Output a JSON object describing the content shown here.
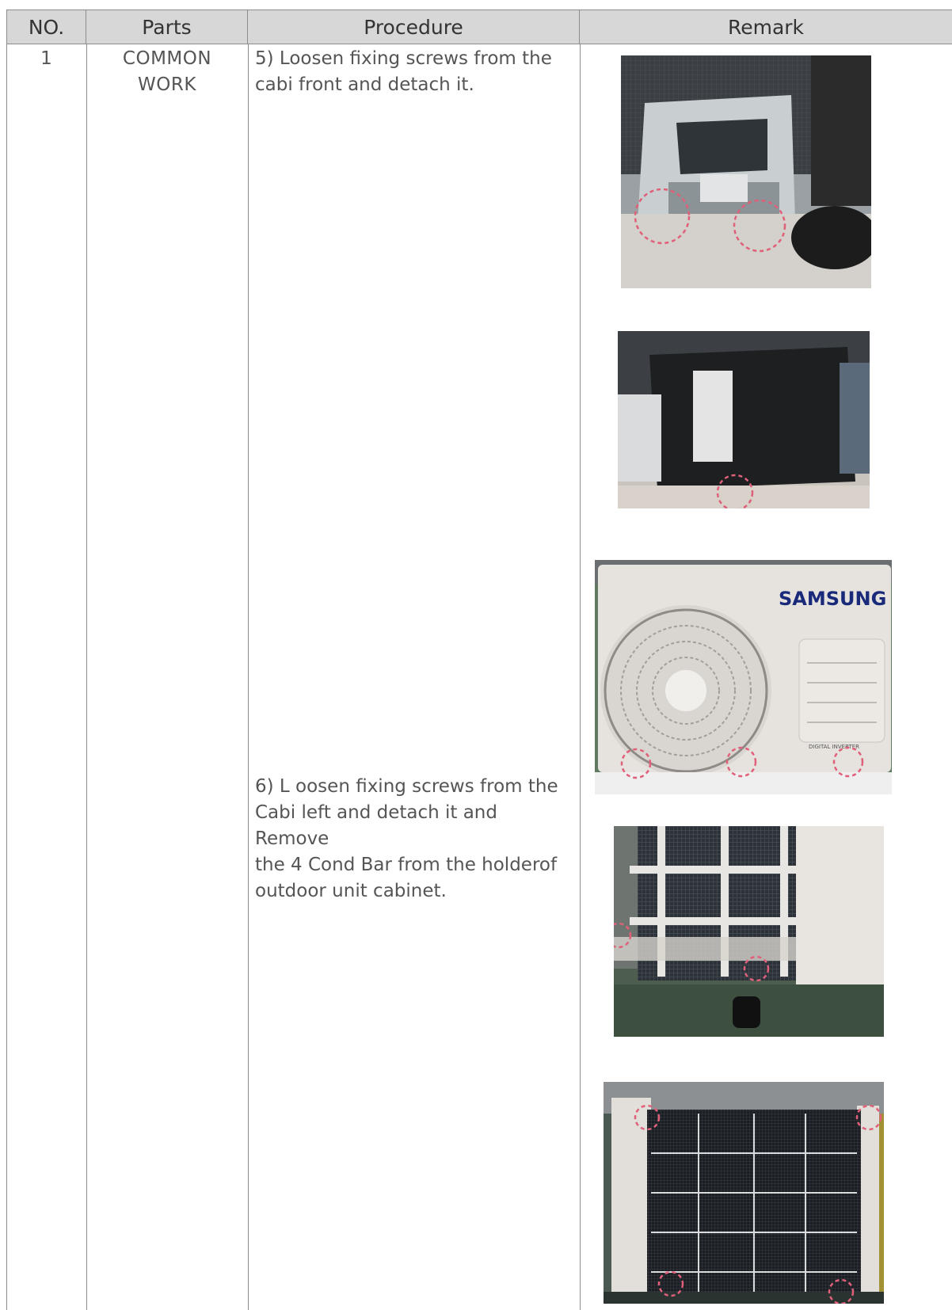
{
  "table": {
    "headers": {
      "no": "NO.",
      "parts": "Parts",
      "procedure": "Procedure",
      "remark": "Remark"
    },
    "row": {
      "no": "1",
      "parts_line1": "COMMON",
      "parts_line2": "WORK",
      "step5_line1": "5) Loosen fixing screws from the",
      "step5_line2": "cabi front and detach it.",
      "step6_line1": "6) L oosen fixing screws from the",
      "step6_line2": "Cabi left and detach it and Remove",
      "step6_line3": "the 4 Cond Bar from the holderof",
      "step6_line4": "outdoor unit cabinet."
    }
  },
  "photos": {
    "brand_text": "SAMSUNG",
    "badge_text": "DIGITAL INVERTER"
  },
  "colors": {
    "header_bg": "#d7d7d7",
    "border": "#8c8c8c",
    "marker": "#e0607a",
    "brand": "#1a2a7a"
  }
}
